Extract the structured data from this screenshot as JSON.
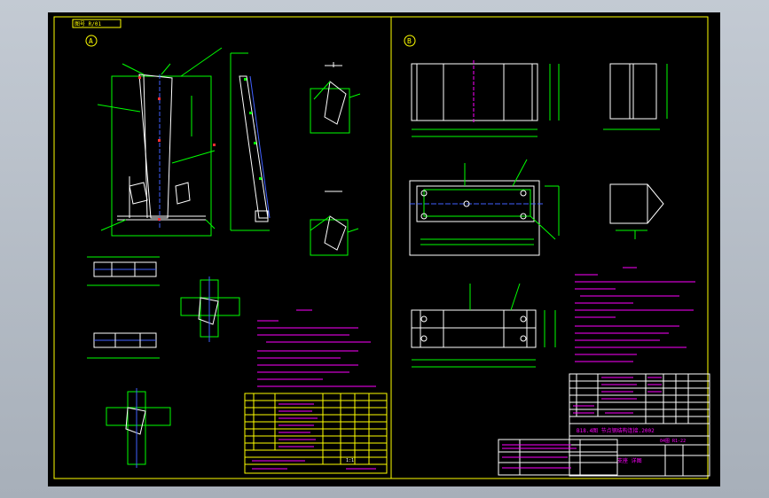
{
  "drawing": {
    "file_tag": "图号 R/01",
    "left_view_marker": "A",
    "right_view_marker": "B",
    "right_title_code": "B18.4图 节点钢结构连接.2002",
    "right_drawing_no": "04图 R1-22",
    "right_bottom_title": "支座 详图",
    "left_sheet_no": "1:1"
  },
  "colors": {
    "frame": "#ffff00",
    "geometry": "#ffffff",
    "dimension": "#00ff00",
    "text": "#ff00ff",
    "centerline": "#4060ff",
    "accent": "#ff3030"
  }
}
